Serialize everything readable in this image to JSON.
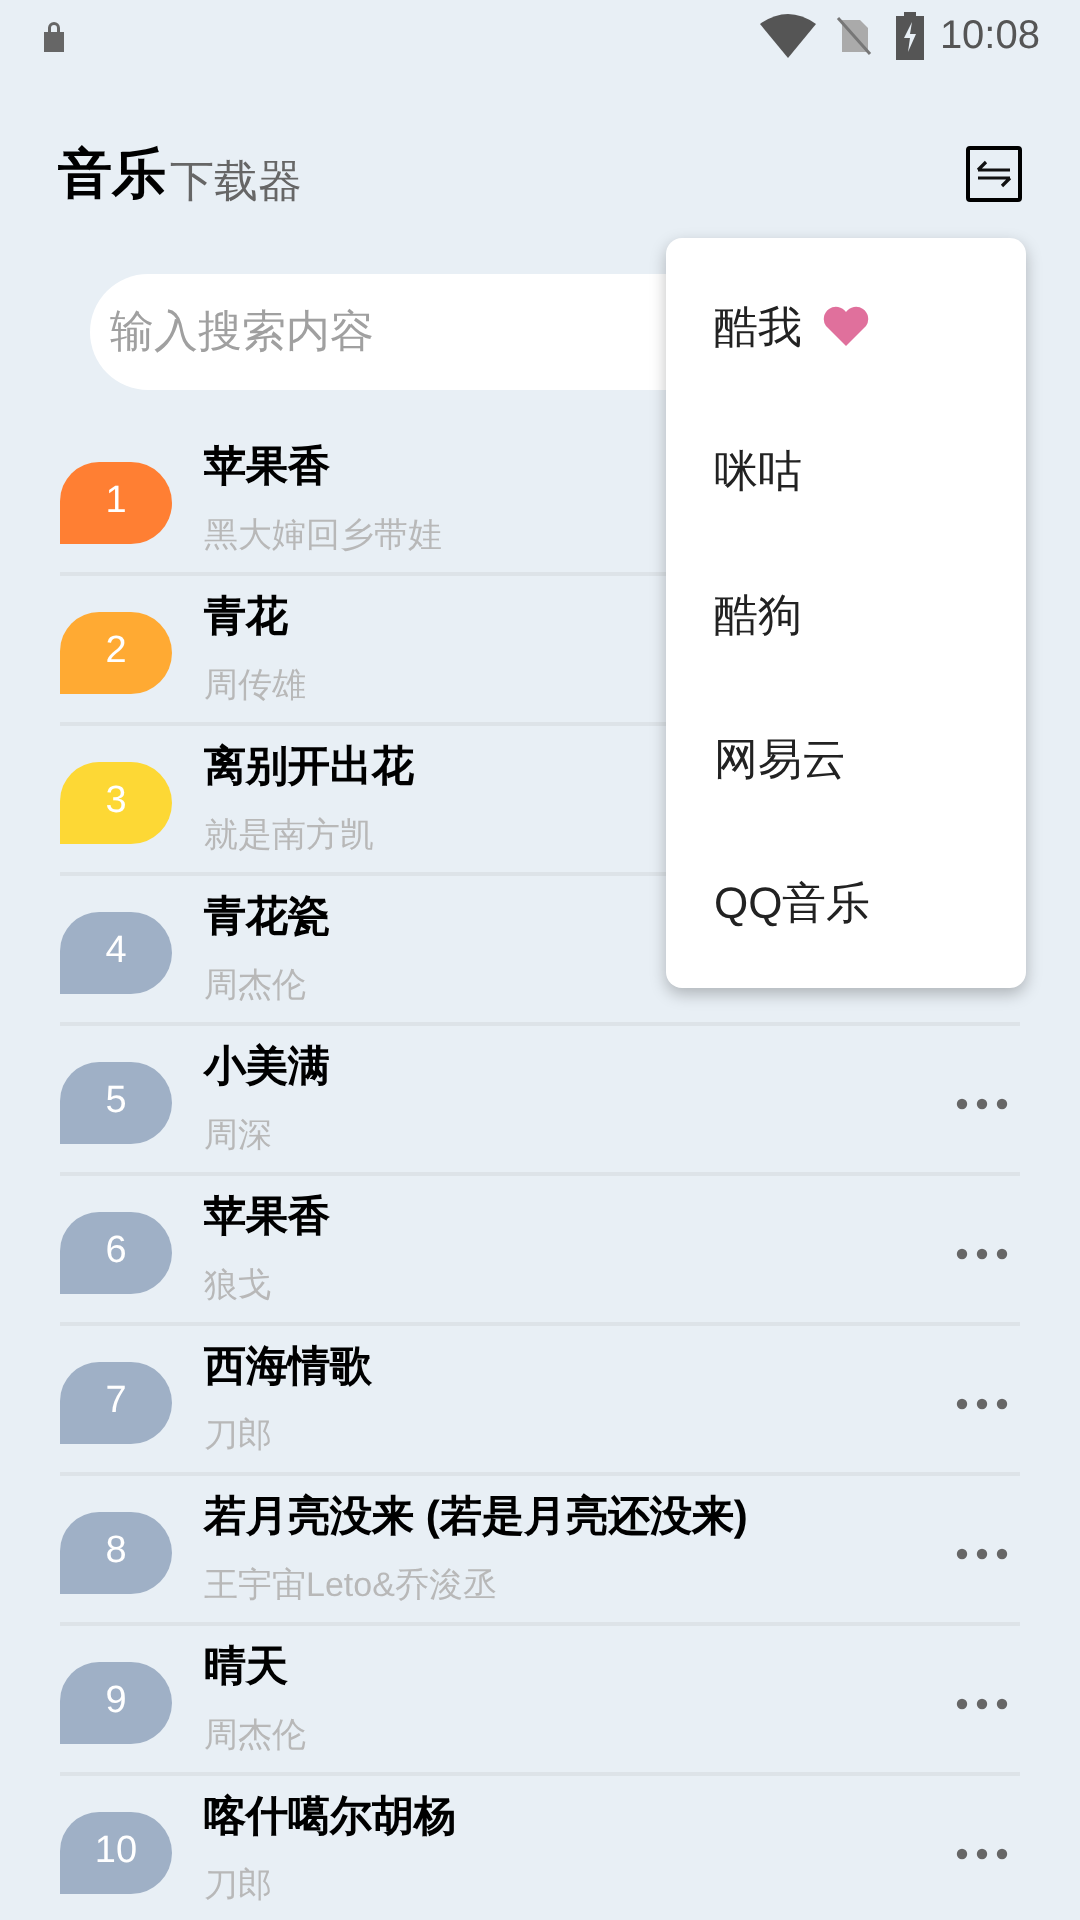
{
  "status_bar": {
    "time": "10:08"
  },
  "header": {
    "title": "音乐",
    "subtitle": "下载器"
  },
  "search": {
    "placeholder": "输入搜索内容"
  },
  "songs": [
    {
      "rank": "1",
      "title": "苹果香",
      "artist": "黑大婶回乡带娃",
      "color": "#ff7f33"
    },
    {
      "rank": "2",
      "title": "青花",
      "artist": "周传雄",
      "color": "#ffaa33"
    },
    {
      "rank": "3",
      "title": "离别开出花",
      "artist": "就是南方凯",
      "color": "#fdd835"
    },
    {
      "rank": "4",
      "title": "青花瓷",
      "artist": "周杰伦",
      "color": "#9fb0c6"
    },
    {
      "rank": "5",
      "title": "小美满",
      "artist": "周深",
      "color": "#9fb0c6"
    },
    {
      "rank": "6",
      "title": "苹果香",
      "artist": "狼戈",
      "color": "#9fb0c6"
    },
    {
      "rank": "7",
      "title": "西海情歌",
      "artist": "刀郎",
      "color": "#9fb0c6"
    },
    {
      "rank": "8",
      "title": "若月亮没来 (若是月亮还没来)",
      "artist": "王宇宙Leto&乔浚丞",
      "color": "#9fb0c6"
    },
    {
      "rank": "9",
      "title": "晴天",
      "artist": "周杰伦",
      "color": "#9fb0c6"
    },
    {
      "rank": "10",
      "title": "喀什噶尔胡杨",
      "artist": "刀郎",
      "color": "#9fb0c6"
    }
  ],
  "source_menu": {
    "items": [
      {
        "label": "酷我",
        "selected": true
      },
      {
        "label": "咪咕",
        "selected": false
      },
      {
        "label": "酷狗",
        "selected": false
      },
      {
        "label": "网易云",
        "selected": false
      },
      {
        "label": "QQ音乐",
        "selected": false
      }
    ]
  }
}
